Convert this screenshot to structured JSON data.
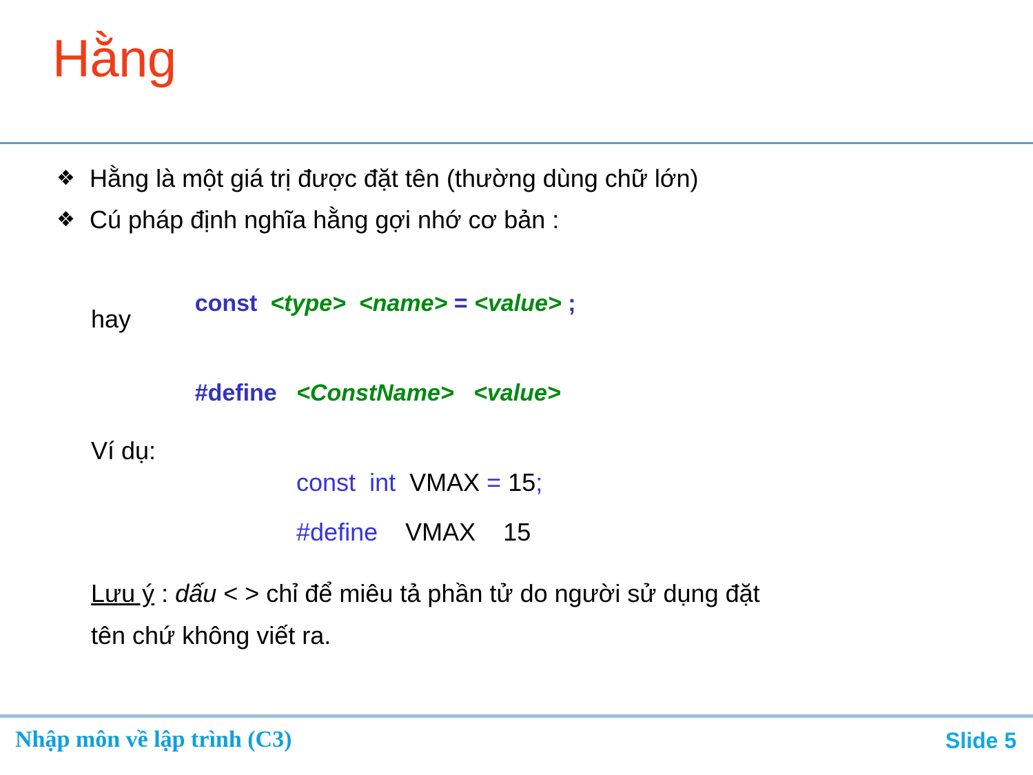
{
  "slide": {
    "title": "Hằng",
    "title_color": "#F03C18",
    "background": "#ffffff",
    "rule_color": "#6699CC",
    "footer_rule_color": "#9DBFD6"
  },
  "bullets": [
    {
      "marker": "❖",
      "text": "Hằng là một giá trị được đặt tên (thường dùng chữ lớn)"
    },
    {
      "marker": "❖",
      "text": "Cú pháp định nghĩa hằng gợi nhớ cơ bản :"
    }
  ],
  "syntax": {
    "const_line": {
      "keyword": "const",
      "type_ph": "<type>",
      "name_ph": "<name>",
      "equals": "=",
      "value_ph": "<value>",
      "semicolon": ";",
      "keyword_color": "#3333BB",
      "placeholder_color": "#008A0E"
    },
    "connector": "hay",
    "define_line": {
      "keyword": "#define",
      "name_ph": "<ConstName>",
      "value_ph": "<value>"
    }
  },
  "example": {
    "label": "Ví dụ:",
    "line1": {
      "kw_const": "const",
      "kw_int": "int",
      "ident": "VMAX",
      "equals": "=",
      "number": "15",
      "semicolon": ";"
    },
    "line2": {
      "kw_define": "#define",
      "ident": "VMAX",
      "number": "15"
    }
  },
  "note": {
    "label": "Lưu ý",
    "colon": " : ",
    "italic_word": "dấu",
    "rest_line1": " < > chỉ để miêu tả phần tử do người sử dụng đặt",
    "line2": "tên chứ không viết ra."
  },
  "footer": {
    "left": "Nhập môn về lập trình (C3)",
    "right": "Slide 5",
    "color": "#11A8E4"
  }
}
